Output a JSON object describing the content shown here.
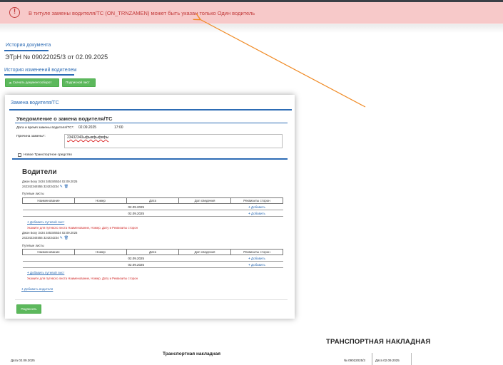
{
  "alert": {
    "icon": "exclamation-circle-icon",
    "text": "В титуле замены водителя/ТС (ON_TRNZAMEN) может быть указан только Один водитель"
  },
  "document": {
    "history_link": "История документа",
    "title": "ЭТрН №   09022025/3  от   02.09.2025",
    "change_history_link": "История изменений водителем",
    "download_button": "Скачать документооборот",
    "sign_sheet_button": "Подписной лист"
  },
  "modal": {
    "title": "Замена водителя/ТС",
    "notice_title": "Уведомление о замена водителя/ТС",
    "datetime_label": "Дата и время замены водителя/ТС*:",
    "date_value": "02.09.2025",
    "time_value": "17:00",
    "reason_label": "Причина замены*:",
    "reason_value": "23432340ыфывфыфвфы",
    "new_vehicle_label": "Новое Транспортное средство",
    "drivers_title": "Водители",
    "drivers": [
      {
        "line1": "Джон Боху 3434 345345534 02.09.2025",
        "line2": "242342344555 324234234",
        "trips_label": "Путевые листы",
        "columns": [
          "Наименование",
          "Номер",
          "Дата",
          "Доп сведения",
          "Реквизиты сторон"
        ],
        "rows": [
          {
            "date": "02.09.2025",
            "action": "Добавить"
          },
          {
            "date": "02.09.2025",
            "action": "Добавить"
          }
        ],
        "add_trip": "Добавить путевой лист",
        "warning": "Укажите для путевого листа Наименование, Номер, Дату и Реквизиты сторон"
      },
      {
        "line1": "Джон Боху 3434 345345534 02.09.2025",
        "line2": "242342344555 324234234",
        "trips_label": "Путевые листы",
        "columns": [
          "Наименование",
          "Номер",
          "Дата",
          "Доп сведения",
          "Реквизиты сторон"
        ],
        "rows": [
          {
            "date": "02.09.2025",
            "action": "Добавить"
          },
          {
            "date": "02.09.2025",
            "action": "Добавить"
          }
        ],
        "add_trip": "Добавить путевой лист",
        "warning": "Укажите для путевого листа Наименование, Номер, Дату и Реквизиты сторон"
      }
    ],
    "add_driver": "Добавить водителя",
    "sign_button": "Подписать"
  },
  "waybill": {
    "date_left": "Дата 02.09.2025",
    "small_title": "Транспортная накладная",
    "big_title": "ТРАНСПОРТНАЯ НАКЛАДНАЯ",
    "number": "№  09022025/3",
    "date_right": "Дата 02.09.2025"
  },
  "colors": {
    "alert_bg": "#f7c9c9",
    "alert_text": "#c23b3b",
    "link": "#2d6cb5",
    "green_button": "#5cb85c",
    "warning_text": "#d12a2a",
    "annotation_arrow": "#f08a24"
  }
}
